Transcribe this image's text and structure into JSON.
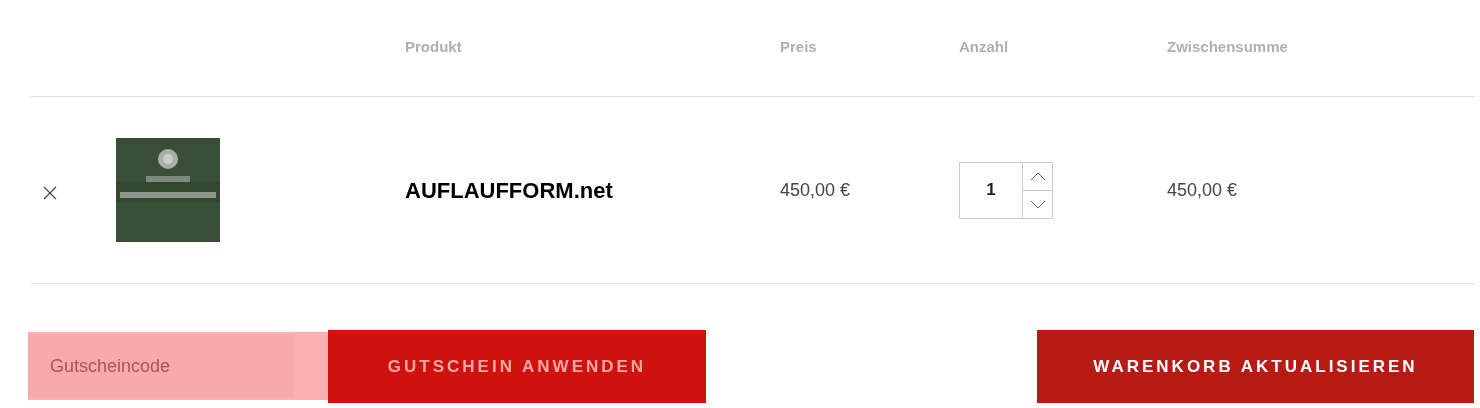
{
  "table": {
    "columns": [
      "Produkt",
      "Preis",
      "Anzahl",
      "Zwischensumme"
    ],
    "rows": [
      {
        "product": "AUFLAUFFORM.net",
        "price": "450,00 €",
        "quantity": "1",
        "subtotal": "450,00 €"
      }
    ]
  },
  "coupon": {
    "placeholder": "Gutscheincode",
    "apply_button": "GUTSCHEIN ANWENDEN"
  },
  "update_button": "WARENKORB AKTUALISIEREN"
}
